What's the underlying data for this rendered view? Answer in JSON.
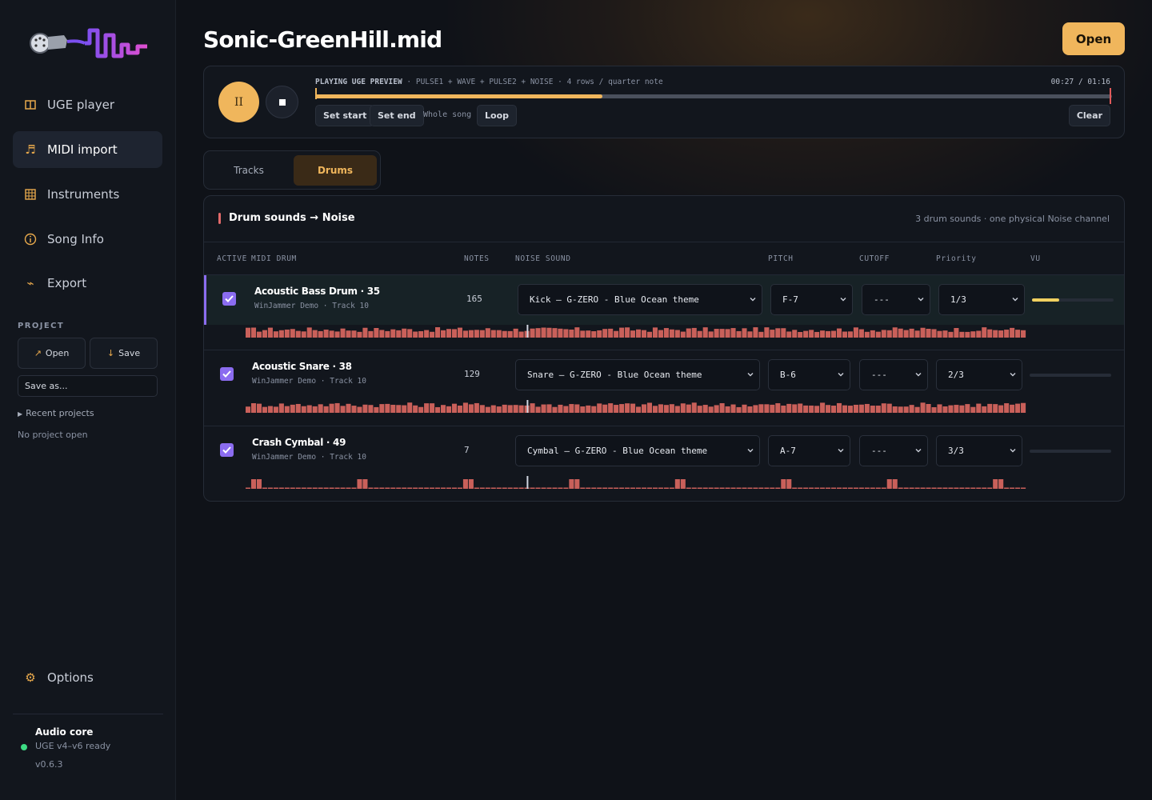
{
  "sidebar": {
    "nav": [
      {
        "label": "UGE player",
        "icon": "columns-icon",
        "active": false
      },
      {
        "label": "MIDI import",
        "icon": "music-note-icon",
        "active": true
      },
      {
        "label": "Instruments",
        "icon": "grid-icon",
        "active": false
      },
      {
        "label": "Song Info",
        "icon": "info-icon",
        "active": false
      },
      {
        "label": "Export",
        "icon": "export-icon",
        "active": false
      }
    ],
    "project_label": "PROJECT",
    "open_label": "Open",
    "save_label": "Save",
    "saveas_placeholder": "Save as...",
    "recent_label": "Recent projects",
    "no_project": "No project open",
    "options_label": "Options",
    "core": {
      "title": "Audio core",
      "status": "UGE v4–v6 ready",
      "version": "v0.6.3",
      "status_color": "#3ddc84"
    }
  },
  "header": {
    "file_title": "Sonic-GreenHill.mid",
    "open_label": "Open"
  },
  "player": {
    "playing_label": "PLAYING UGE PREVIEW",
    "channels": "· PULSE1 + WAVE + PULSE2 + NOISE · 4 rows / quarter note",
    "time": "00:27 / 01:16",
    "progress": 0.36,
    "set_start": "Set start",
    "set_end": "Set end",
    "whole_song": "Whole song",
    "loop": "Loop",
    "clear": "Clear"
  },
  "tabs": [
    {
      "label": "Tracks",
      "active": false
    },
    {
      "label": "Drums",
      "active": true
    }
  ],
  "drums": {
    "title": "Drum sounds → Noise",
    "subtitle": "3 drum sounds · one physical Noise channel",
    "columns": {
      "active": "ACTIVE",
      "midi_drum": "MIDI DRUM",
      "notes": "NOTES",
      "noise_sound": "NOISE SOUND",
      "pitch": "PITCH",
      "cutoff": "CUTOFF",
      "priority": "Priority",
      "vu": "VU"
    },
    "rows": [
      {
        "name": "Acoustic Bass Drum · 35",
        "source": "WinJammer Demo · Track 10",
        "notes": "165",
        "sound": "Kick — G-ZERO - Blue Ocean theme",
        "pitch": "F-7",
        "cutoff": "---",
        "priority": "1/3",
        "vu": 0.33,
        "active": true,
        "selected": true
      },
      {
        "name": "Acoustic Snare · 38",
        "source": "WinJammer Demo · Track 10",
        "notes": "129",
        "sound": "Snare — G-ZERO - Blue Ocean theme",
        "pitch": "B-6",
        "cutoff": "---",
        "priority": "2/3",
        "vu": 0,
        "active": true,
        "selected": false
      },
      {
        "name": "Crash Cymbal · 49",
        "source": "WinJammer Demo · Track 10",
        "notes": "7",
        "sound": "Cymbal — G-ZERO - Blue Ocean theme",
        "pitch": "A-7",
        "cutoff": "---",
        "priority": "3/3",
        "vu": 0,
        "active": true,
        "selected": false
      }
    ]
  },
  "colors": {
    "accent": "#f0b65c",
    "check": "#8b6cf0",
    "hit": "#c9605a",
    "playhead": "#cfd5e0",
    "end_marker": "#e05a5a"
  }
}
